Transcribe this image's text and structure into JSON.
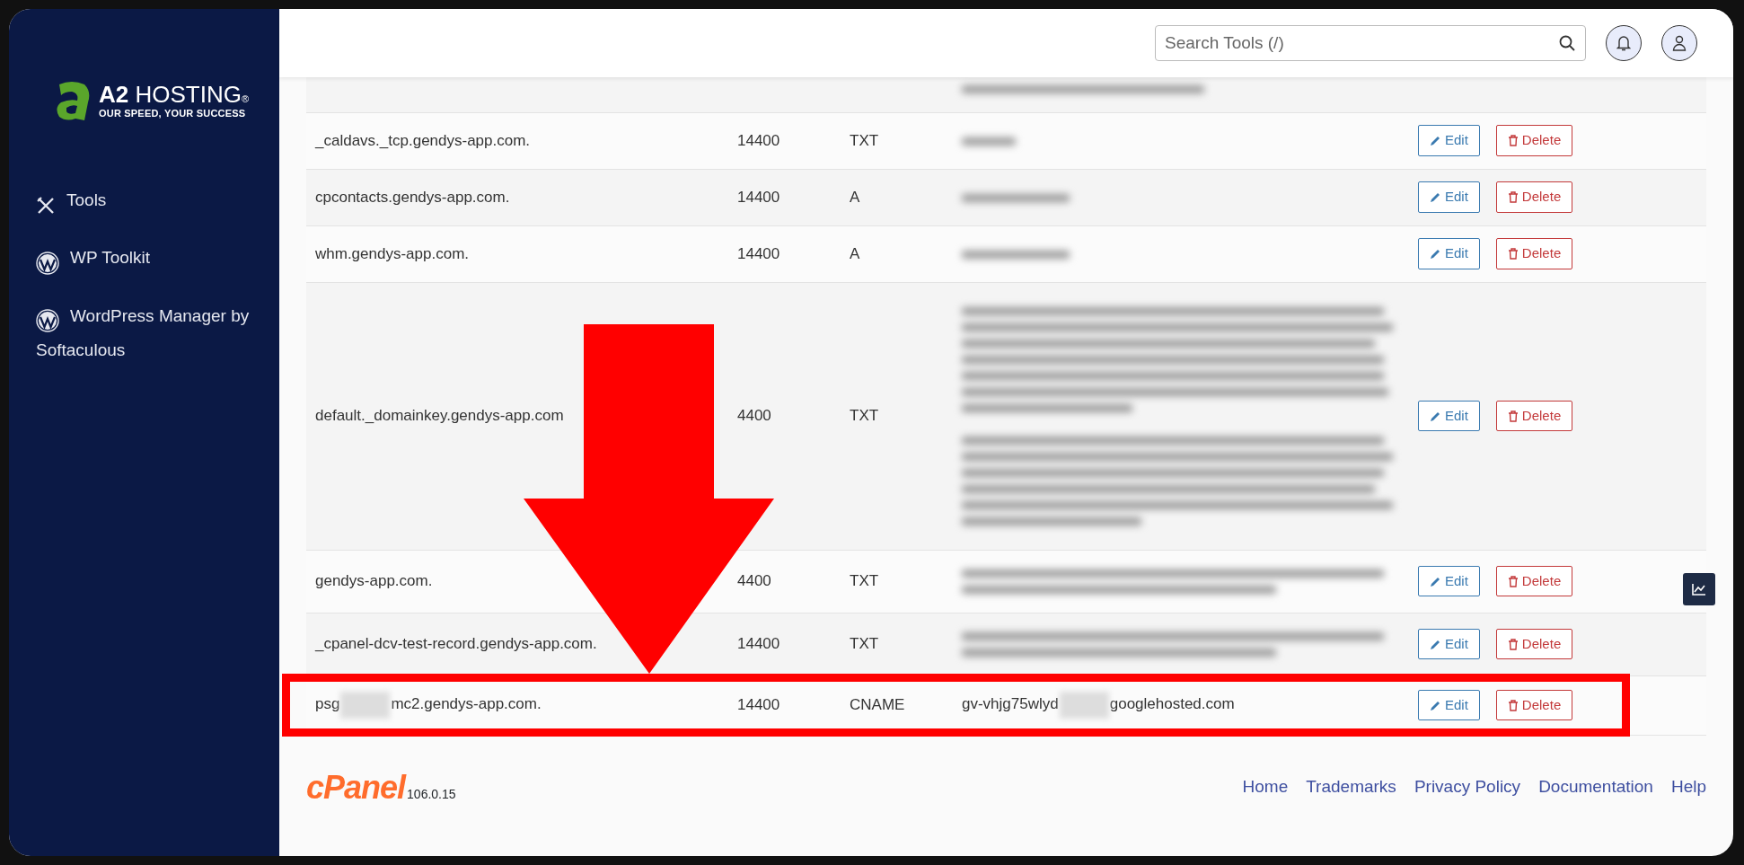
{
  "brand": {
    "name": "A2 HOSTING",
    "tagline": "OUR SPEED, YOUR SUCCESS",
    "mark": "®"
  },
  "sidebar": {
    "items": [
      {
        "label": "Tools"
      },
      {
        "label": "WP Toolkit"
      },
      {
        "label": "WordPress Manager by Softaculous"
      }
    ]
  },
  "header": {
    "search": {
      "placeholder": "Search Tools (/)"
    }
  },
  "table": {
    "rows": [
      {
        "kind": "partial"
      },
      {
        "kind": "tiny",
        "name_segments": [
          "_caldavs._tcp.gendys-app.com."
        ],
        "ttl": "14400",
        "type": "TXT",
        "edit_label": "Edit",
        "delete_label": "Delete"
      },
      {
        "kind": "short",
        "name_segments": [
          "cpcontacts.gendys-app.com."
        ],
        "ttl": "14400",
        "type": "A",
        "edit_label": "Edit",
        "delete_label": "Delete"
      },
      {
        "kind": "short",
        "name_segments": [
          "whm.gendys-app.com."
        ],
        "ttl": "14400",
        "type": "A",
        "edit_label": "Edit",
        "delete_label": "Delete"
      },
      {
        "kind": "block",
        "name_segments": [
          "default._domainkey.gendys-app.com"
        ],
        "ttl": "4400",
        "type": "TXT",
        "edit_label": "Edit",
        "delete_label": "Delete"
      },
      {
        "kind": "two",
        "name_segments": [
          "gendys-app.com."
        ],
        "ttl": "4400",
        "type": "TXT",
        "edit_label": "Edit",
        "delete_label": "Delete"
      },
      {
        "kind": "two",
        "name_segments": [
          "_cpanel-dcv-test-record.gendys-app.com."
        ],
        "ttl": "14400",
        "type": "TXT",
        "edit_label": "Edit",
        "delete_label": "Delete"
      },
      {
        "kind": "text",
        "name_segments": [
          "psg",
          "mc2.gendys-app.com."
        ],
        "ttl": "14400",
        "type": "CNAME",
        "value_segments": [
          "gv-vhjg75wlyd",
          "googlehosted.com"
        ],
        "edit_label": "Edit",
        "delete_label": "Delete"
      }
    ]
  },
  "footer": {
    "logo": "cPanel",
    "version": "106.0.15",
    "links": [
      "Home",
      "Trademarks",
      "Privacy Policy",
      "Documentation",
      "Help"
    ]
  }
}
